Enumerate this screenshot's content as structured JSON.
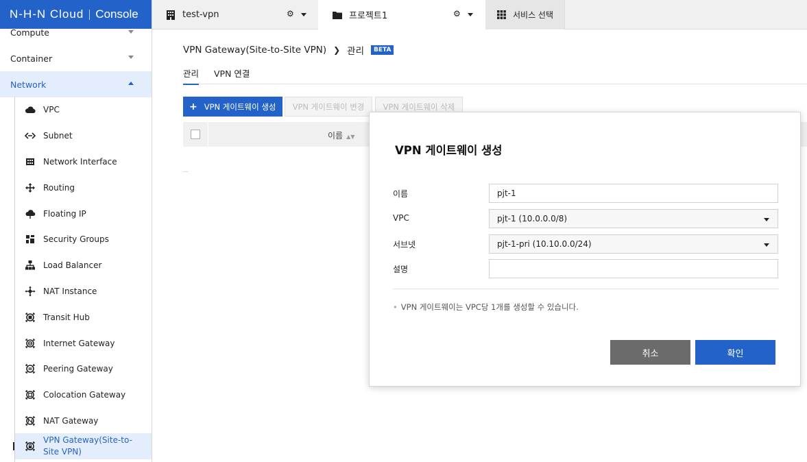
{
  "brand": {
    "logo": "N-H-N Cloud",
    "console": "Console"
  },
  "sidebar": {
    "categories": [
      {
        "label": "Compute"
      },
      {
        "label": "Container"
      },
      {
        "label": "Network"
      }
    ],
    "items": [
      {
        "label": "VPC",
        "icon": "cloud-icon"
      },
      {
        "label": "Subnet",
        "icon": "subnet-icon"
      },
      {
        "label": "Network Interface",
        "icon": "network-interface-icon"
      },
      {
        "label": "Routing",
        "icon": "routing-icon"
      },
      {
        "label": "Floating IP",
        "icon": "floating-ip-icon"
      },
      {
        "label": "Security Groups",
        "icon": "security-groups-icon"
      },
      {
        "label": "Load Balancer",
        "icon": "load-balancer-icon"
      },
      {
        "label": "NAT Instance",
        "icon": "nat-instance-icon"
      },
      {
        "label": "Transit Hub",
        "icon": "transit-hub-icon"
      },
      {
        "label": "Internet Gateway",
        "icon": "internet-gateway-icon"
      },
      {
        "label": "Peering Gateway",
        "icon": "peering-gateway-icon"
      },
      {
        "label": "Colocation Gateway",
        "icon": "colocation-gateway-icon"
      },
      {
        "label": "NAT Gateway",
        "icon": "nat-gateway-icon"
      },
      {
        "label": "VPN Gateway(Site-to-Site VPN)",
        "icon": "vpn-gateway-icon"
      }
    ]
  },
  "topbar": {
    "org": "test-vpn",
    "project": "프로젝트1",
    "services": "서비스 선택"
  },
  "breadcrumb": {
    "parent": "VPN Gateway(Site-to-Site VPN)",
    "current": "관리",
    "badge": "BETA"
  },
  "tabs": [
    {
      "label": "관리"
    },
    {
      "label": "VPN 연결"
    }
  ],
  "toolbar": {
    "create": "VPN 게이트웨이 생성",
    "edit": "VPN 게이트웨이 변경",
    "delete": "VPN 게이트웨이 삭제"
  },
  "table": {
    "columns": [
      "이름"
    ]
  },
  "modal": {
    "title": "VPN 게이트웨이 생성",
    "fields": {
      "name": {
        "label": "이름",
        "value": "pjt-1"
      },
      "vpc": {
        "label": "VPC",
        "value": "pjt-1 (10.0.0.0/8)"
      },
      "subnet": {
        "label": "서브넷",
        "value": "pjt-1-pri (10.10.0.0/24)"
      },
      "description": {
        "label": "설명",
        "value": ""
      }
    },
    "note": "VPN 게이트웨이는 VPC당 1개를 생성할 수 있습니다.",
    "cancel": "취소",
    "confirm": "확인"
  },
  "colors": {
    "accent": "#2363c9",
    "active_bg": "#e4edfb",
    "cancel": "#6b6b6b"
  }
}
